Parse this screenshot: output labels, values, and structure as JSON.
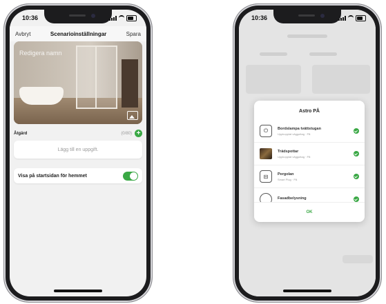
{
  "left_phone": {
    "status": {
      "time": "10:36"
    },
    "navbar": {
      "cancel": "Avbryt",
      "title": "Scenarioinställningar",
      "save": "Spara"
    },
    "hero": {
      "name_placeholder": "Redigera namn"
    },
    "actions": {
      "label": "Åtgärd",
      "count": "(0/80)"
    },
    "add_task": "Lägg till en uppgift.",
    "show_on_home": {
      "label": "Visa på startsidan för hemmet",
      "enabled": true
    }
  },
  "right_phone": {
    "status": {
      "time": "10:36"
    },
    "dialog": {
      "title": "Astro PÅ",
      "items": [
        {
          "name": "Bordslampa tvättstugan",
          "sub": "Uppkopplat vägguttag · På",
          "icon": "power-icon",
          "checked": true
        },
        {
          "name": "Trädspottar",
          "sub": "Uppkopplat vägguttag · På",
          "icon": "tree-thumbnail",
          "checked": true
        },
        {
          "name": "Pergolan",
          "sub": "Smart Plug · På",
          "icon": "plug-icon",
          "checked": true
        },
        {
          "name": "Fasadbelysning",
          "sub": "",
          "icon": "bulb-icon",
          "checked": true
        }
      ],
      "ok": "OK"
    }
  },
  "colors": {
    "accent": "#3aa845"
  }
}
